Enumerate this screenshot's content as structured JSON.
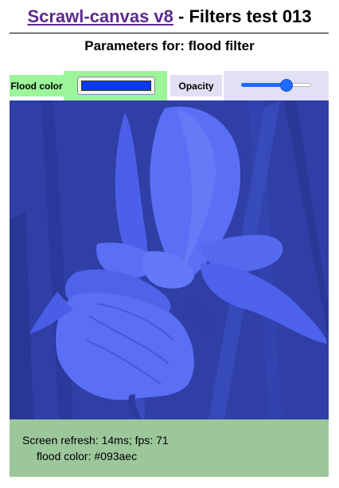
{
  "header": {
    "link_text": "Scrawl-canvas v8",
    "title_suffix": " - Filters test 013",
    "subtitle": "Parameters for: flood filter"
  },
  "controls": {
    "flood_color_label": "Flood color",
    "flood_color_value": "#093aec",
    "opacity_label": "Opacity",
    "opacity_value": 0.65
  },
  "canvas": {
    "image_subject": "blue iris flower with flood filter applied"
  },
  "status": {
    "refresh_line": "Screen refresh: 14ms; fps: 71",
    "color_line": "flood color: #093aec"
  },
  "colors": {
    "link": "#5b2a8c",
    "control_green": "#9df59a",
    "control_lavender": "#e2e0f5",
    "status_green": "#9cc79a",
    "slider_blue": "#1e6bff"
  }
}
